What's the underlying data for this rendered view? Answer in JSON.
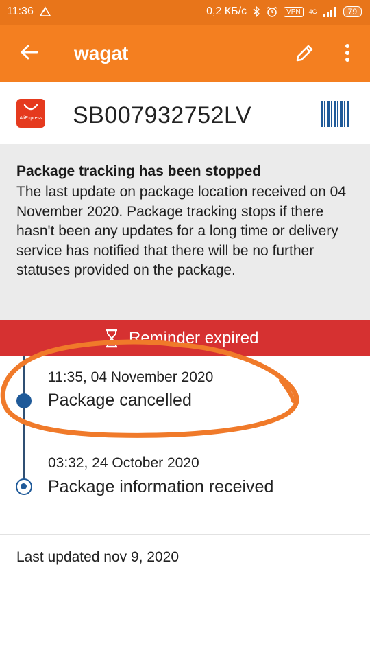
{
  "status_bar": {
    "time": "11:36",
    "network_speed": "0,2 КБ/с",
    "vpn_label": "VPN",
    "network_type": "4G",
    "battery": "79"
  },
  "app_bar": {
    "title": "wagat"
  },
  "package": {
    "store_brand": "AliExpress",
    "tracking_number": "SB007932752LV"
  },
  "notice": {
    "title": "Package tracking has been stopped",
    "body": "The last update on package location received on 04 November 2020. Package tracking stops if there hasn't been any updates for a long time or delivery service has notified that there will be no further statuses provided on the package."
  },
  "reminder": {
    "label": "Reminder expired"
  },
  "events": [
    {
      "time": "11:35, 04 November 2020",
      "status": "Package cancelled"
    },
    {
      "time": "03:32, 24 October 2020",
      "status": "Package information received"
    }
  ],
  "footer": {
    "last_updated": "Last updated nov 9, 2020"
  },
  "colors": {
    "app_bar": "#f47f20",
    "status_bar": "#e8751a",
    "reminder": "#d63131",
    "timeline": "#1f5a99",
    "annotation": "#f07a2a"
  }
}
